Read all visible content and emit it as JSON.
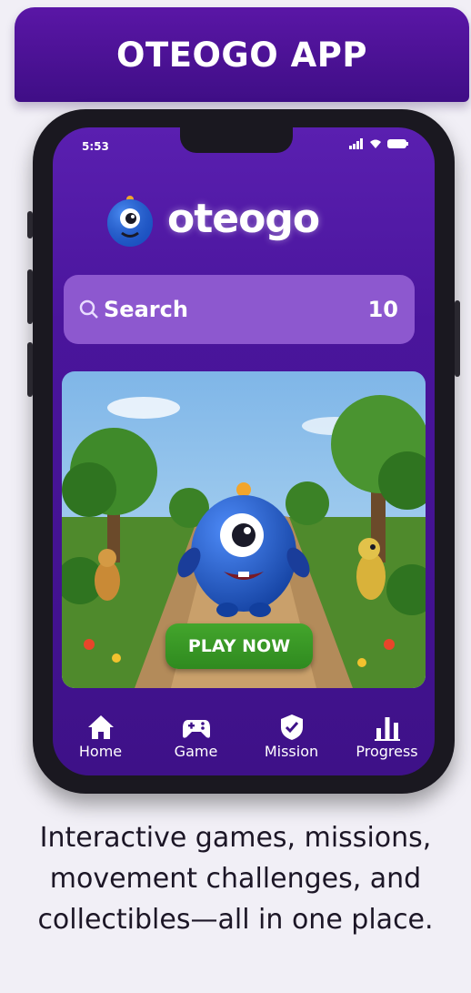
{
  "banner": {
    "title": "OTEOGO APP"
  },
  "phone": {
    "status_time": "5:53",
    "brand": "oteogo",
    "search": {
      "label": "Search",
      "count": "10"
    },
    "hero": {
      "play_label": "PLAY NOW"
    },
    "nav": [
      {
        "label": "Home",
        "icon": "home-icon"
      },
      {
        "label": "Game",
        "icon": "gamepad-icon"
      },
      {
        "label": "Mission",
        "icon": "mission-icon"
      },
      {
        "label": "Progress",
        "icon": "progress-icon"
      }
    ]
  },
  "caption": "Interactive games, missions, movement challenges, and collectibles—all in one place.",
  "colors": {
    "brand_purple": "#4a159c",
    "search_purple": "#8d58cf",
    "play_green": "#3a9a26"
  }
}
